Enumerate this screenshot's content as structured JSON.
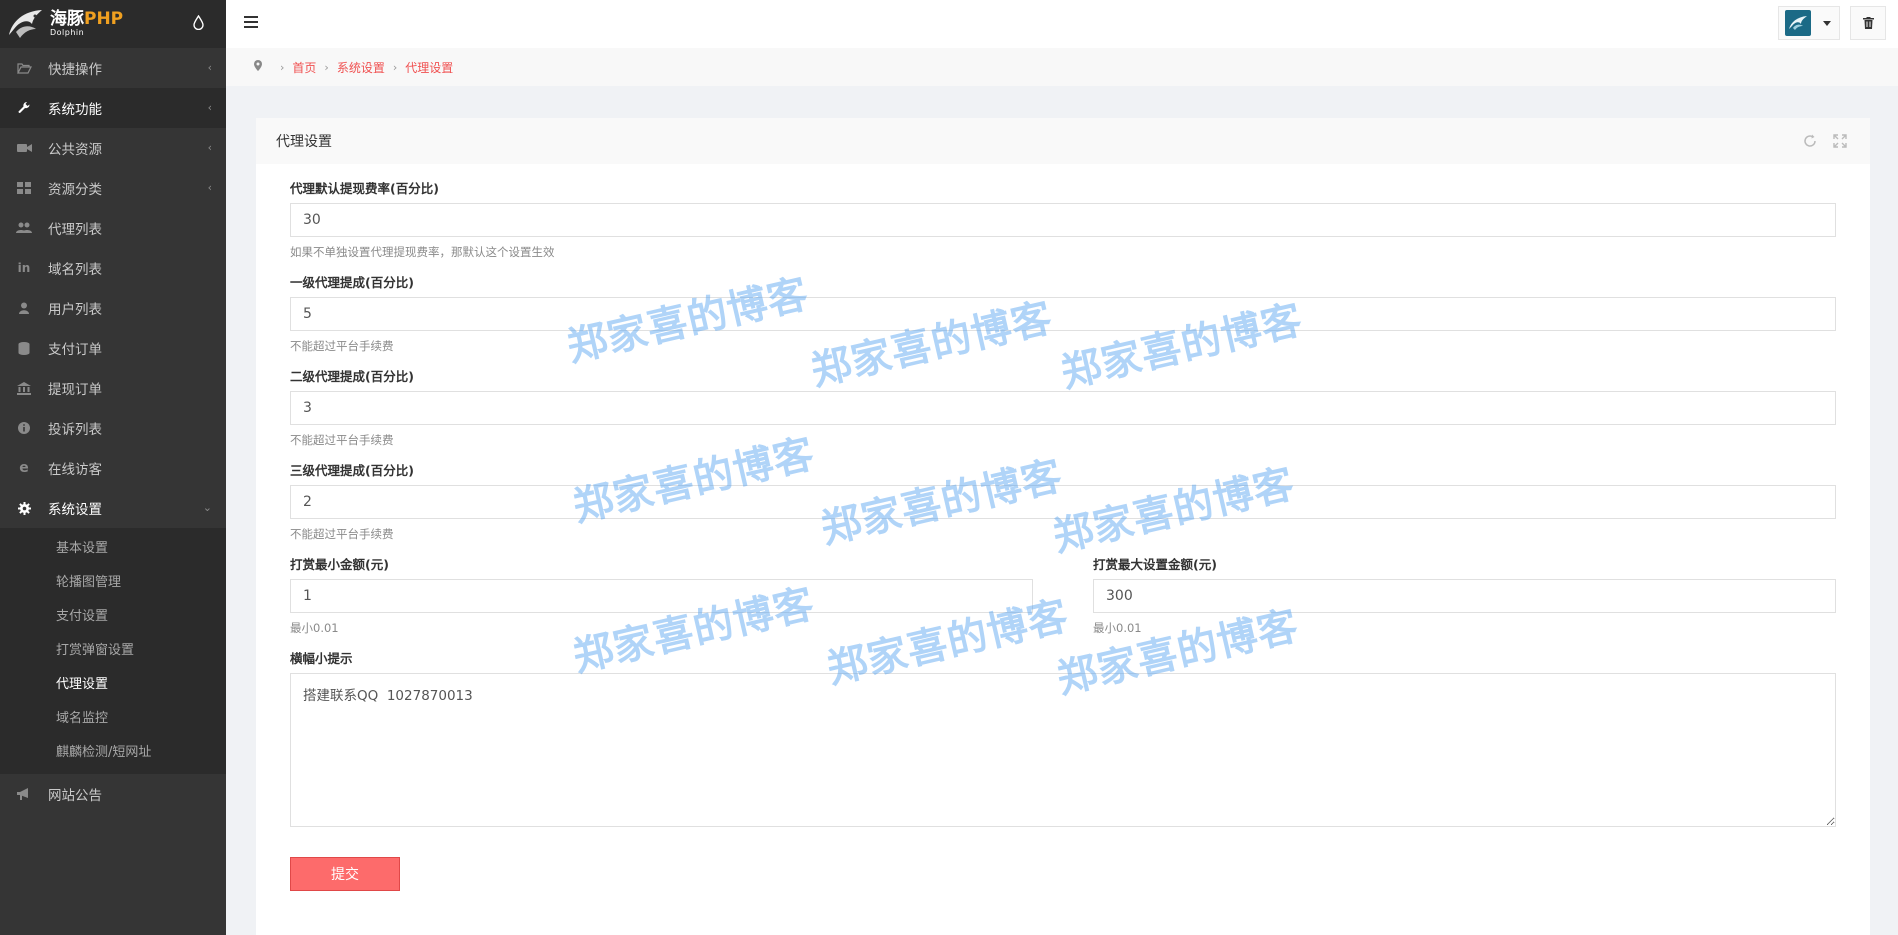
{
  "brand": {
    "name_cn": "海豚",
    "name_en": "PHP",
    "sub": "Dolphin"
  },
  "sidebar": {
    "items": [
      {
        "label": "快捷操作",
        "icon": "folder-open-icon"
      },
      {
        "label": "系统功能",
        "icon": "wrench-icon"
      },
      {
        "label": "公共资源",
        "icon": "video-camera-icon"
      },
      {
        "label": "资源分类",
        "icon": "th-large-icon"
      },
      {
        "label": "代理列表",
        "icon": "users-icon"
      },
      {
        "label": "域名列表",
        "icon": "linkedin-icon"
      },
      {
        "label": "用户列表",
        "icon": "user-icon"
      },
      {
        "label": "支付订单",
        "icon": "database-icon"
      },
      {
        "label": "提现订单",
        "icon": "bank-icon"
      },
      {
        "label": "投诉列表",
        "icon": "info-circle-icon"
      },
      {
        "label": "在线访客",
        "icon": "ie-icon"
      },
      {
        "label": "系统设置",
        "icon": "gear-icon"
      },
      {
        "label": "网站公告",
        "icon": "bullhorn-icon"
      }
    ],
    "sub_items": [
      "基本设置",
      "轮播图管理",
      "支付设置",
      "打赏弹窗设置",
      "代理设置",
      "域名监控",
      "麒麟检测/短网址"
    ]
  },
  "breadcrumb": [
    "首页",
    "系统设置",
    "代理设置"
  ],
  "panel": {
    "title": "代理设置",
    "fields": {
      "withdraw_rate": {
        "label": "代理默认提现费率(百分比)",
        "value": "30",
        "help": "如果不单独设置代理提现费率，那默认这个设置生效"
      },
      "level1": {
        "label": "一级代理提成(百分比)",
        "value": "5",
        "help": "不能超过平台手续费"
      },
      "level2": {
        "label": "二级代理提成(百分比)",
        "value": "3",
        "help": "不能超过平台手续费"
      },
      "level3": {
        "label": "三级代理提成(百分比)",
        "value": "2",
        "help": "不能超过平台手续费"
      },
      "min_reward": {
        "label": "打赏最小金额(元)",
        "value": "1",
        "help": "最小0.01"
      },
      "max_reward": {
        "label": "打赏最大设置金额(元)",
        "value": "300",
        "help": "最小0.01"
      },
      "banner_tip": {
        "label": "横幅小提示",
        "value": "搭建联系QQ  1027870013"
      }
    },
    "submit": "提交"
  },
  "watermark": "郑家喜的博客"
}
